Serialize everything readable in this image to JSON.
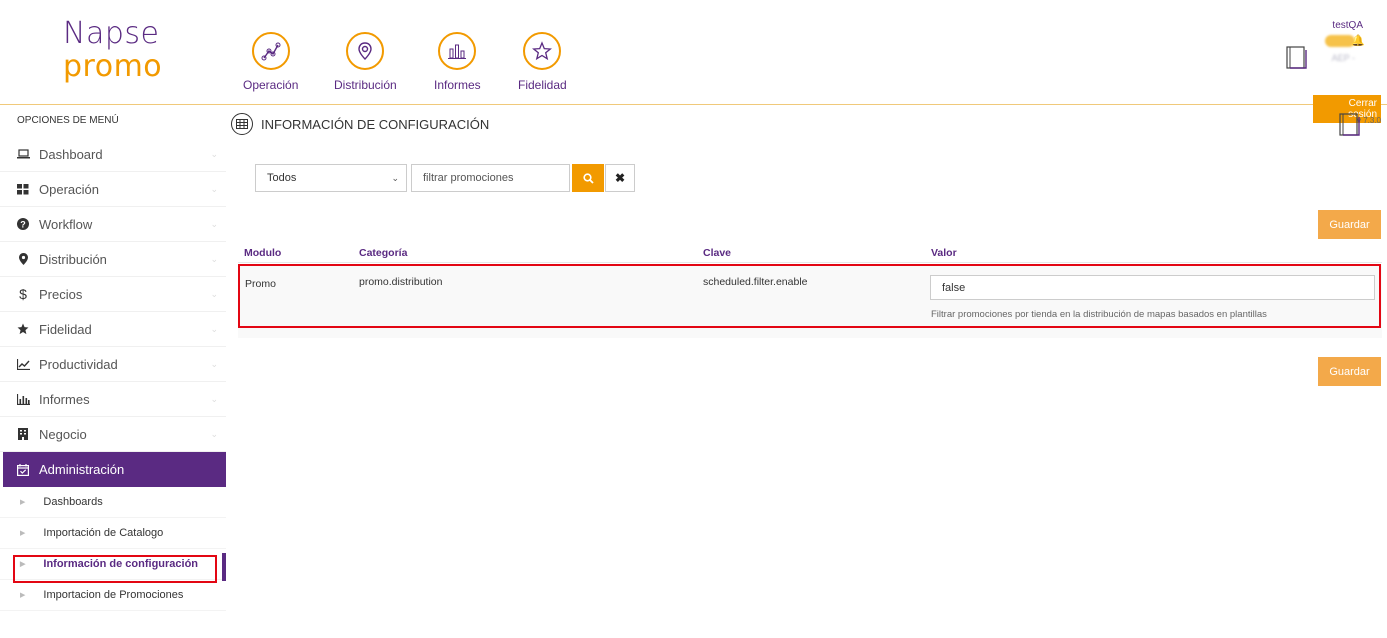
{
  "brand": {
    "line1": "Napse",
    "line2": "promo"
  },
  "topnav": [
    {
      "label": "Operación",
      "icon": "chart-line-icon"
    },
    {
      "label": "Distribución",
      "icon": "map-pin-icon"
    },
    {
      "label": "Informes",
      "icon": "bar-chart-icon"
    },
    {
      "label": "Fidelidad",
      "icon": "star-icon"
    }
  ],
  "user": {
    "name": "testQA",
    "logout": "Cerrar sesión",
    "version": "v 7.3.0"
  },
  "sidebar": {
    "title": "OPCIONES DE MENÚ",
    "items": [
      {
        "label": "Dashboard",
        "icon": "laptop-icon"
      },
      {
        "label": "Operación",
        "icon": "grid-icon"
      },
      {
        "label": "Workflow",
        "icon": "question-circle-icon"
      },
      {
        "label": "Distribución",
        "icon": "map-marker-icon"
      },
      {
        "label": "Precios",
        "icon": "dollar-icon"
      },
      {
        "label": "Fidelidad",
        "icon": "star-icon"
      },
      {
        "label": "Productividad",
        "icon": "line-chart-icon"
      },
      {
        "label": "Informes",
        "icon": "bar-chart-icon"
      },
      {
        "label": "Negocio",
        "icon": "building-icon"
      },
      {
        "label": "Administración",
        "icon": "calendar-check-icon"
      }
    ],
    "subitems": [
      {
        "label": "Dashboards"
      },
      {
        "label": "Importación de Catalogo"
      },
      {
        "label": "Información de configuración"
      },
      {
        "label": "Importacion de Promociones"
      }
    ]
  },
  "page": {
    "title": "INFORMACIÓN DE CONFIGURACIÓN",
    "filter": {
      "selected": "Todos",
      "search_text": "filtrar promociones"
    },
    "save_label": "Guardar",
    "columns": [
      "Modulo",
      "Categoría",
      "Clave",
      "Valor"
    ],
    "rows": [
      {
        "modulo": "Promo",
        "categoria": "promo.distribution",
        "clave": "scheduled.filter.enable",
        "valor": "false",
        "help": "Filtrar promociones por tienda en la distribución de mapas basados en plantillas"
      }
    ]
  },
  "colors": {
    "accent": "#f29a00",
    "brand": "#5a2a82",
    "highlight": "#e30613"
  }
}
